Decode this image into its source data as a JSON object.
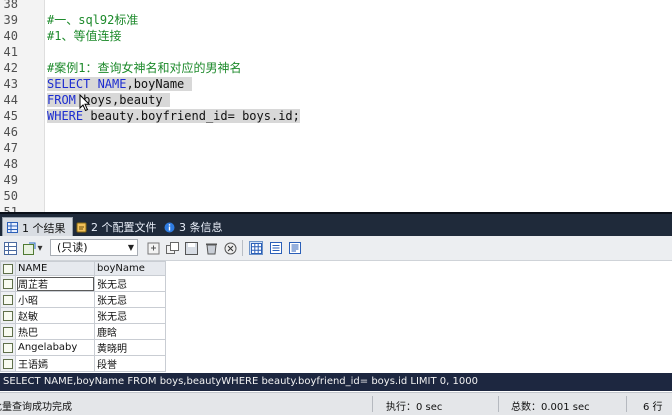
{
  "editor": {
    "lines": [
      {
        "num": "38",
        "tokens": []
      },
      {
        "num": "39",
        "tokens": [
          {
            "t": "#一、sql92标准",
            "c": "c-comment"
          }
        ]
      },
      {
        "num": "40",
        "tokens": [
          {
            "t": "#1、等值连接",
            "c": "c-comment"
          }
        ]
      },
      {
        "num": "41",
        "tokens": []
      },
      {
        "num": "42",
        "tokens": [
          {
            "t": "#案例1：查询女神名和对应的男神名",
            "c": "c-comment"
          }
        ]
      },
      {
        "num": "43",
        "tokens": [
          {
            "t": "SELECT NAME",
            "c": "c-kw",
            "sel": true
          },
          {
            "t": ",boyName ",
            "c": "c-text",
            "sel": true
          }
        ]
      },
      {
        "num": "44",
        "tokens": [
          {
            "t": "FROM",
            "c": "c-kw",
            "sel": true
          },
          {
            "t": " boys,beauty ",
            "c": "c-text",
            "sel": true
          }
        ]
      },
      {
        "num": "45",
        "tokens": [
          {
            "t": "WHERE",
            "c": "c-kw",
            "sel": true
          },
          {
            "t": " beauty.boyfriend_id= boys.id;",
            "c": "c-text",
            "sel": true
          }
        ]
      },
      {
        "num": "46",
        "tokens": []
      },
      {
        "num": "47",
        "tokens": []
      },
      {
        "num": "48",
        "tokens": []
      },
      {
        "num": "49",
        "tokens": []
      },
      {
        "num": "50",
        "tokens": []
      },
      {
        "num": "51",
        "tokens": []
      }
    ]
  },
  "tabs": [
    {
      "label": "1 个结果",
      "icon": "table-grid-icon"
    },
    {
      "label": "2 个配置文件",
      "icon": "profile-icon"
    },
    {
      "label": "3 条信息",
      "icon": "info-icon"
    }
  ],
  "toolbar": {
    "mode": "(只读)"
  },
  "grid": {
    "columns": [
      "NAME",
      "boyName"
    ],
    "rows": [
      [
        "周芷若",
        "张无忌"
      ],
      [
        "小昭",
        "张无忌"
      ],
      [
        "赵敏",
        "张无忌"
      ],
      [
        "热巴",
        "鹿晗"
      ],
      [
        "Angelababy",
        "黄晓明"
      ],
      [
        "王语嫣",
        "段誉"
      ]
    ]
  },
  "sqlbar": {
    "text": "SELECT NAME,boyName FROM boys,beautyWHERE beauty.boyfriend_id= boys.id LIMIT 0, 1000"
  },
  "status": {
    "message": "批量查询成功完成",
    "exec": "执行：0 sec",
    "total": "总数：0.001 sec",
    "rows": "6 行"
  },
  "colors": {
    "keyword": "#1d2dd0",
    "comment": "#1d8a2b",
    "tabbar": "#1f2a3a",
    "sqlbar": "#1d2740"
  }
}
